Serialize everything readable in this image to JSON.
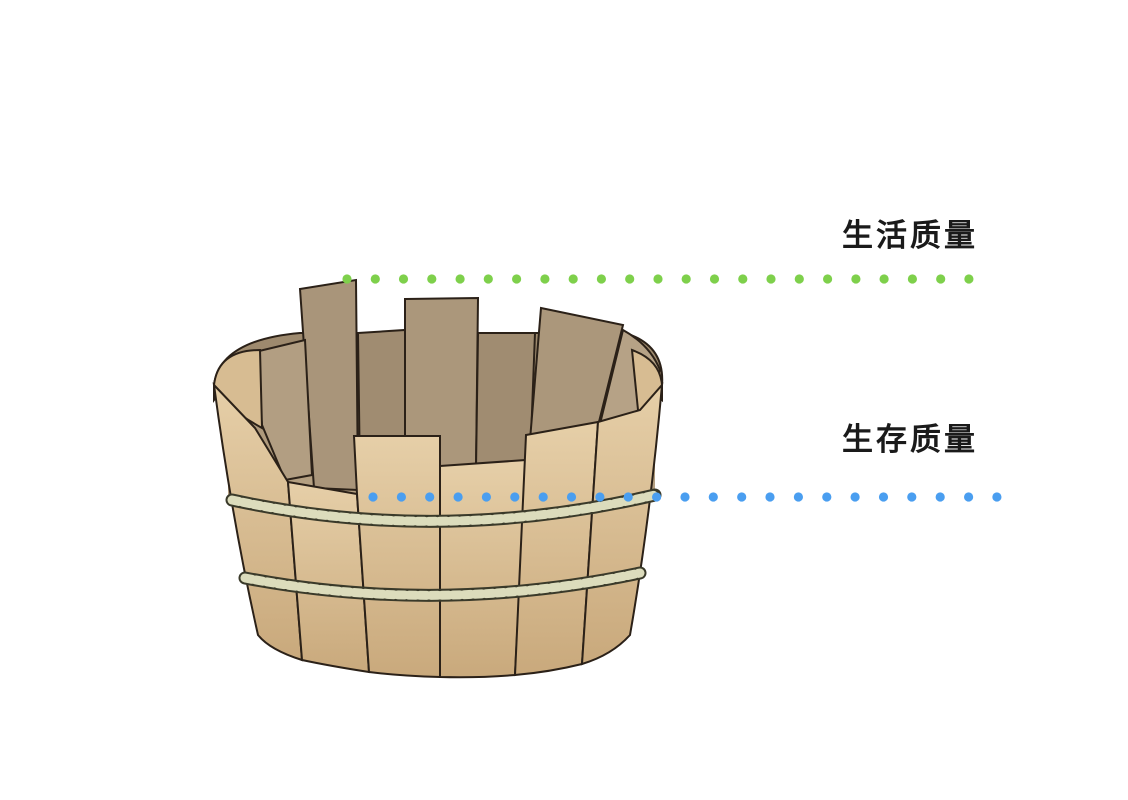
{
  "labels": {
    "upper": "生活质量",
    "lower": "生存质量"
  },
  "colors": {
    "upper_line": "#7ed04b",
    "lower_line": "#4a9ef0",
    "stave_front": "#d9bc92",
    "stave_inner": "#a89478",
    "rope": "#dcdcbc",
    "outline": "#2b2118"
  },
  "icons": {
    "illustration": "wooden-bucket-icon"
  }
}
